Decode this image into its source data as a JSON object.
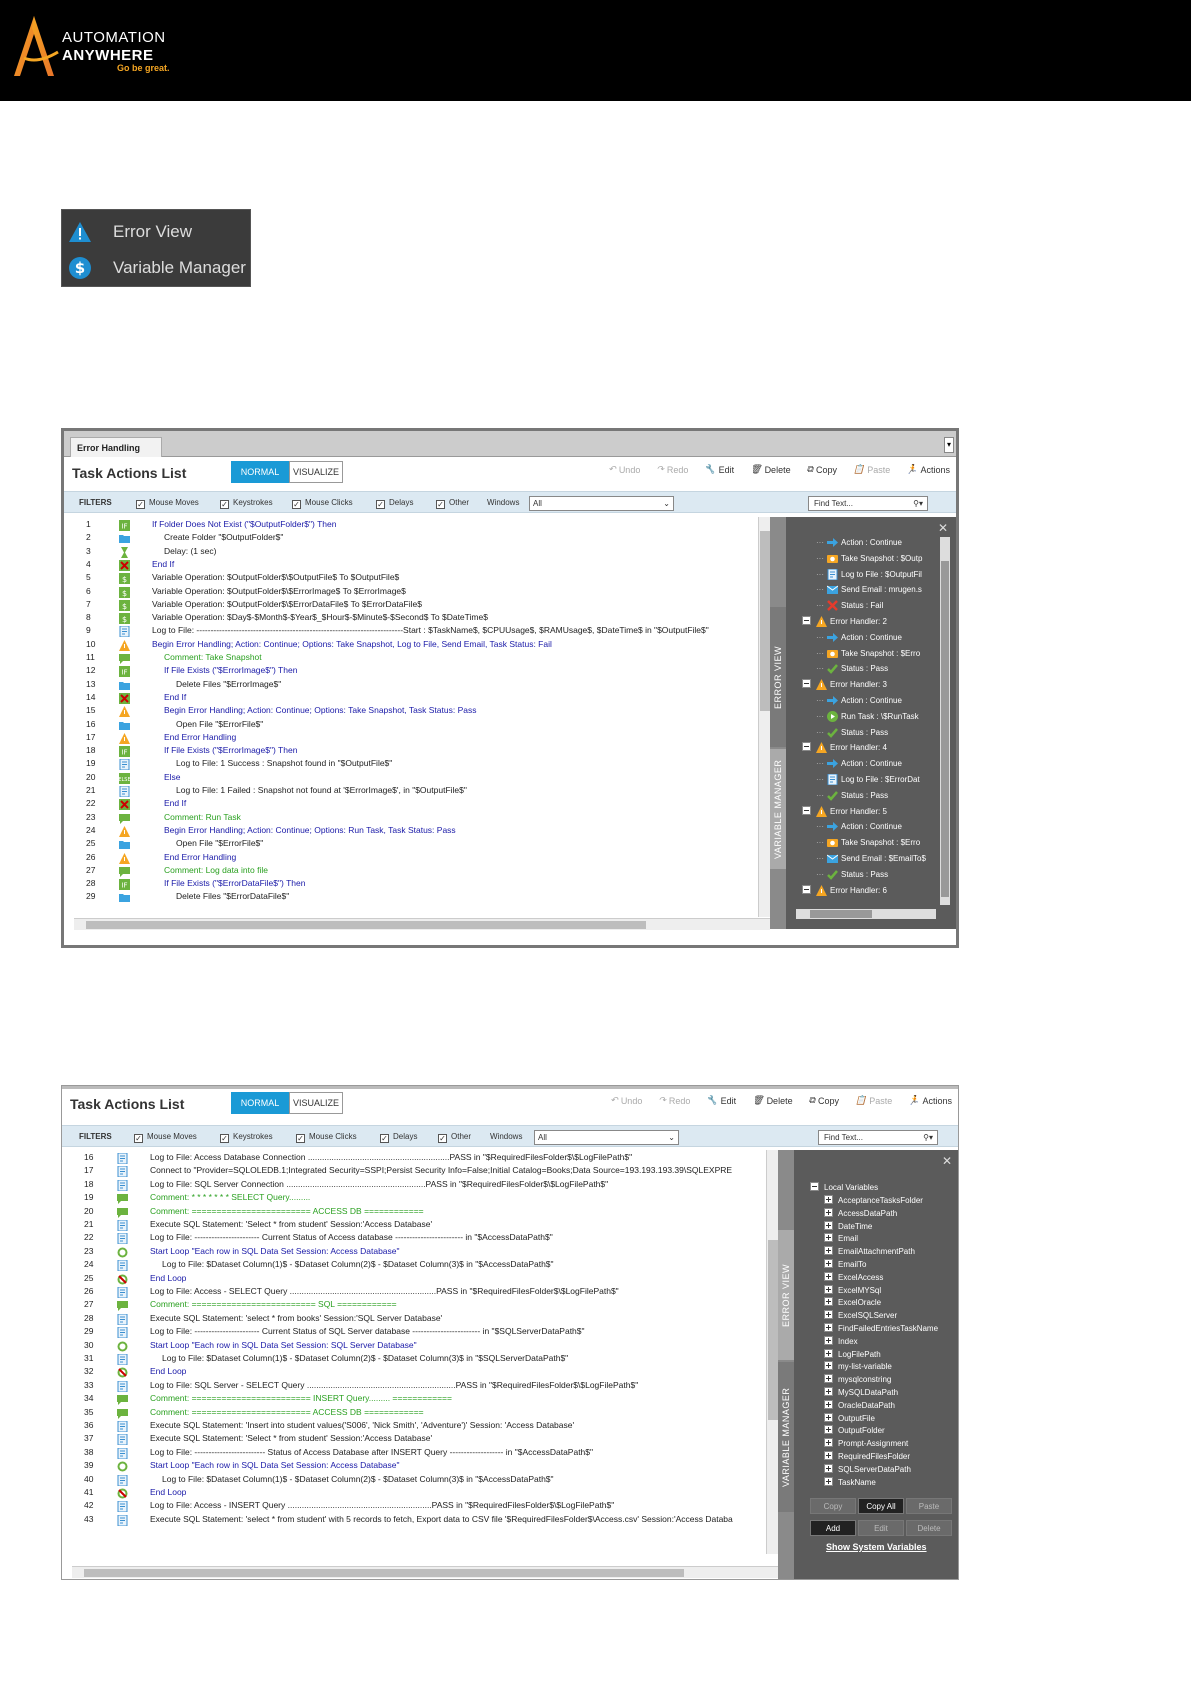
{
  "header": {
    "brand_line1": "AUTOMATION",
    "brand_line2": "ANYWHERE",
    "tagline": "Go be great."
  },
  "legend": {
    "items": [
      {
        "label": "Error View",
        "icon": "warning-icon"
      },
      {
        "label": "Variable Manager",
        "icon": "dollar-icon"
      }
    ]
  },
  "colors": {
    "accent": "#1a9ad6",
    "panel": "#5b5b5b",
    "warning": "#f5a623",
    "comment": "#2aa020",
    "keyword": "#1a1aa8"
  },
  "window1": {
    "tab_label": "Error Handling",
    "title": "Task Actions List",
    "modes": {
      "normal": "NORMAL",
      "visualize": "VISUALIZE"
    },
    "toolbar": {
      "undo": "Undo",
      "redo": "Redo",
      "edit": "Edit",
      "delete": "Delete",
      "copy": "Copy",
      "paste": "Paste",
      "actions": "Actions"
    },
    "filters": {
      "label": "FILTERS",
      "mouse_moves": "Mouse Moves",
      "keystrokes": "Keystrokes",
      "mouse_clicks": "Mouse Clicks",
      "delays": "Delays",
      "other": "Other",
      "windows_label": "Windows",
      "windows_value": "All",
      "find_placeholder": "Find Text..."
    },
    "lines": [
      {
        "n": "1",
        "ind": 0,
        "c": "blue",
        "i": "if",
        "t": "If Folder Does Not Exist (\"$OutputFolder$\") Then"
      },
      {
        "n": "2",
        "ind": 1,
        "c": "black",
        "i": "folder",
        "t": "Create Folder \"$OutputFolder$\""
      },
      {
        "n": "3",
        "ind": 1,
        "c": "black",
        "i": "delay",
        "t": "Delay: (1 sec)"
      },
      {
        "n": "4",
        "ind": 0,
        "c": "blue",
        "i": "endif",
        "t": "End If"
      },
      {
        "n": "5",
        "ind": 0,
        "c": "black",
        "i": "var",
        "t": "Variable Operation: $OutputFolder$\\$OutputFile$ To $OutputFile$"
      },
      {
        "n": "6",
        "ind": 0,
        "c": "black",
        "i": "var",
        "t": "Variable Operation: $OutputFolder$\\$ErrorImage$ To $ErrorImage$"
      },
      {
        "n": "7",
        "ind": 0,
        "c": "black",
        "i": "var",
        "t": "Variable Operation: $OutputFolder$\\$ErrorDataFile$ To $ErrorDataFile$"
      },
      {
        "n": "8",
        "ind": 0,
        "c": "black",
        "i": "var",
        "t": "Variable Operation: $Day$-$Month$-$Year$_$Hour$-$Minute$-$Second$ To $DateTime$"
      },
      {
        "n": "9",
        "ind": 0,
        "c": "black",
        "i": "log",
        "t": "Log to File: -------------------------------------------------------------------------Start : $TaskName$, $CPUUsage$, $RAMUsage$, $DateTime$ in \"$OutputFile$\""
      },
      {
        "n": "10",
        "ind": 0,
        "c": "blue",
        "i": "warn",
        "t": "Begin Error Handling; Action: Continue; Options: Take Snapshot, Log to File, Send Email,  Task Status: Fail"
      },
      {
        "n": "11",
        "ind": 1,
        "c": "green",
        "i": "comment",
        "t": "Comment: Take Snapshot"
      },
      {
        "n": "12",
        "ind": 1,
        "c": "blue",
        "i": "if",
        "t": "If File Exists (\"$ErrorImage$\") Then"
      },
      {
        "n": "13",
        "ind": 2,
        "c": "black",
        "i": "folder",
        "t": "Delete Files \"$ErrorImage$\""
      },
      {
        "n": "14",
        "ind": 1,
        "c": "blue",
        "i": "endif",
        "t": "End If"
      },
      {
        "n": "15",
        "ind": 1,
        "c": "blue",
        "i": "warn",
        "t": "Begin Error Handling; Action: Continue; Options: Take Snapshot,  Task Status: Pass"
      },
      {
        "n": "16",
        "ind": 2,
        "c": "black",
        "i": "folder",
        "t": "Open File \"$ErrorFile$\""
      },
      {
        "n": "17",
        "ind": 1,
        "c": "blue",
        "i": "warn",
        "t": "End Error Handling"
      },
      {
        "n": "18",
        "ind": 1,
        "c": "blue",
        "i": "if",
        "t": "If File Exists (\"$ErrorImage$\") Then"
      },
      {
        "n": "19",
        "ind": 2,
        "c": "black",
        "i": "log",
        "t": "Log to File: 1 Success : Snapshot found in \"$OutputFile$\""
      },
      {
        "n": "20",
        "ind": 1,
        "c": "blue",
        "i": "else",
        "t": "Else"
      },
      {
        "n": "21",
        "ind": 2,
        "c": "black",
        "i": "log",
        "t": "Log to File: 1 Failed : Snapshot not found at '$ErrorImage$', in \"$OutputFile$\""
      },
      {
        "n": "22",
        "ind": 1,
        "c": "blue",
        "i": "endif",
        "t": "End If"
      },
      {
        "n": "23",
        "ind": 1,
        "c": "green",
        "i": "comment",
        "t": "Comment: Run Task"
      },
      {
        "n": "24",
        "ind": 1,
        "c": "blue",
        "i": "warn",
        "t": "Begin Error Handling; Action: Continue; Options: Run Task,  Task Status: Pass"
      },
      {
        "n": "25",
        "ind": 2,
        "c": "black",
        "i": "folder",
        "t": "Open File \"$ErrorFile$\""
      },
      {
        "n": "26",
        "ind": 1,
        "c": "blue",
        "i": "warn",
        "t": "End Error Handling"
      },
      {
        "n": "27",
        "ind": 1,
        "c": "green",
        "i": "comment",
        "t": "Comment: Log data into file"
      },
      {
        "n": "28",
        "ind": 1,
        "c": "blue",
        "i": "if",
        "t": "If File Exists (\"$ErrorDataFile$\") Then"
      },
      {
        "n": "29",
        "ind": 2,
        "c": "black",
        "i": "folder",
        "t": "Delete Files \"$ErrorDataFile$\""
      }
    ],
    "side_tabs": {
      "error_view": "ERROR VIEW",
      "variable_manager": "VARIABLE MANAGER"
    },
    "error_tree": [
      {
        "lv": 1,
        "i": "arrow",
        "t": "Action : Continue"
      },
      {
        "lv": 1,
        "i": "camera",
        "t": "Take Snapshot : $Outp"
      },
      {
        "lv": 1,
        "i": "log",
        "t": "Log to File : $OutputFil"
      },
      {
        "lv": 1,
        "i": "mail",
        "t": "Send Email : mrugen.s"
      },
      {
        "lv": 1,
        "i": "x",
        "t": "Status : Fail"
      },
      {
        "lv": 0,
        "i": "warn",
        "t": "Error Handler: 2"
      },
      {
        "lv": 1,
        "i": "arrow",
        "t": "Action : Continue"
      },
      {
        "lv": 1,
        "i": "camera",
        "t": "Take Snapshot : $Erro"
      },
      {
        "lv": 1,
        "i": "check",
        "t": "Status : Pass"
      },
      {
        "lv": 0,
        "i": "warn",
        "t": "Error Handler: 3"
      },
      {
        "lv": 1,
        "i": "arrow",
        "t": "Action : Continue"
      },
      {
        "lv": 1,
        "i": "play",
        "t": "Run Task : \\$RunTask"
      },
      {
        "lv": 1,
        "i": "check",
        "t": "Status : Pass"
      },
      {
        "lv": 0,
        "i": "warn",
        "t": "Error Handler: 4"
      },
      {
        "lv": 1,
        "i": "arrow",
        "t": "Action : Continue"
      },
      {
        "lv": 1,
        "i": "log",
        "t": "Log to File : $ErrorDat"
      },
      {
        "lv": 1,
        "i": "check",
        "t": "Status : Pass"
      },
      {
        "lv": 0,
        "i": "warn",
        "t": "Error Handler: 5"
      },
      {
        "lv": 1,
        "i": "arrow",
        "t": "Action : Continue"
      },
      {
        "lv": 1,
        "i": "camera",
        "t": "Take Snapshot : $Erro"
      },
      {
        "lv": 1,
        "i": "mail",
        "t": "Send Email : $EmailTo$"
      },
      {
        "lv": 1,
        "i": "check",
        "t": "Status : Pass"
      },
      {
        "lv": 0,
        "i": "warn",
        "t": "Error Handler: 6"
      }
    ]
  },
  "window2": {
    "title": "Task Actions List",
    "modes": {
      "normal": "NORMAL",
      "visualize": "VISUALIZE"
    },
    "toolbar": {
      "undo": "Undo",
      "redo": "Redo",
      "edit": "Edit",
      "delete": "Delete",
      "copy": "Copy",
      "paste": "Paste",
      "actions": "Actions"
    },
    "filters": {
      "label": "FILTERS",
      "mouse_moves": "Mouse Moves",
      "keystrokes": "Keystrokes",
      "mouse_clicks": "Mouse Clicks",
      "delays": "Delays",
      "other": "Other",
      "windows_label": "Windows",
      "windows_value": "All",
      "find_placeholder": "Find Text..."
    },
    "lines": [
      {
        "n": "16",
        "ind": 0,
        "c": "black",
        "i": "log",
        "t": "Log to File: Access Database Connection ............................................................PASS in \"$RequiredFilesFolder$\\$LogFilePath$\""
      },
      {
        "n": "17",
        "ind": 0,
        "c": "black",
        "i": "log",
        "t": "Connect to \"Provider=SQLOLEDB.1;Integrated Security=SSPI;Persist Security Info=False;Initial Catalog=Books;Data Source=193.193.193.39\\SQLEXPRE"
      },
      {
        "n": "18",
        "ind": 0,
        "c": "black",
        "i": "log",
        "t": "Log to File: SQL Server Connection ...........................................................PASS in \"$RequiredFilesFolder$\\$LogFilePath$\""
      },
      {
        "n": "19",
        "ind": 0,
        "c": "green",
        "i": "comment",
        "t": "Comment: * * * * * * *                   SELECT Query........."
      },
      {
        "n": "20",
        "ind": 0,
        "c": "green",
        "i": "comment",
        "t": "Comment: ========================     ACCESS DB ============"
      },
      {
        "n": "21",
        "ind": 0,
        "c": "black",
        "i": "log",
        "t": "Execute SQL Statement: 'Select * from student' Session:'Access Database'"
      },
      {
        "n": "22",
        "ind": 0,
        "c": "black",
        "i": "log",
        "t": "Log to File: ----------------------- Current Status of Access database ------------------------ in \"$AccessDataPath$\""
      },
      {
        "n": "23",
        "ind": 0,
        "c": "blue",
        "i": "loop",
        "t": "Start Loop \"Each row in SQL Data Set Session: Access Database\""
      },
      {
        "n": "24",
        "ind": 1,
        "c": "black",
        "i": "log",
        "t": "Log to File: $Dataset Column(1)$ - $Dataset Column(2)$ - $Dataset Column(3)$ in \"$AccessDataPath$\""
      },
      {
        "n": "25",
        "ind": 0,
        "c": "blue",
        "i": "endloop",
        "t": "End Loop"
      },
      {
        "n": "26",
        "ind": 0,
        "c": "black",
        "i": "log",
        "t": "Log to File: Access - SELECT Query ..............................................................PASS in \"$RequiredFilesFolder$\\$LogFilePath$\""
      },
      {
        "n": "27",
        "ind": 0,
        "c": "green",
        "i": "comment",
        "t": "Comment: ========================= SQL   ============"
      },
      {
        "n": "28",
        "ind": 0,
        "c": "black",
        "i": "log",
        "t": "Execute SQL Statement: 'select * from books' Session:'SQL Server Database'"
      },
      {
        "n": "29",
        "ind": 0,
        "c": "black",
        "i": "log",
        "t": "Log to File: ----------------------- Current Status of SQL Server database ------------------------ in \"$SQLServerDataPath$\""
      },
      {
        "n": "30",
        "ind": 0,
        "c": "blue",
        "i": "loop",
        "t": "Start Loop \"Each row in SQL Data Set Session: SQL Server Database\""
      },
      {
        "n": "31",
        "ind": 1,
        "c": "black",
        "i": "log",
        "t": "Log to File: $Dataset Column(1)$ - $Dataset Column(2)$ - $Dataset Column(3)$ in \"$SQLServerDataPath$\""
      },
      {
        "n": "32",
        "ind": 0,
        "c": "blue",
        "i": "endloop",
        "t": "End Loop"
      },
      {
        "n": "33",
        "ind": 0,
        "c": "black",
        "i": "log",
        "t": "Log to File: SQL Server - SELECT Query ...............................................................PASS in \"$RequiredFilesFolder$\\$LogFilePath$\""
      },
      {
        "n": "34",
        "ind": 0,
        "c": "green",
        "i": "comment",
        "t": "Comment: ========================               INSERT Query.........    ============"
      },
      {
        "n": "35",
        "ind": 0,
        "c": "green",
        "i": "comment",
        "t": "Comment: ========================     ACCESS DB ============"
      },
      {
        "n": "36",
        "ind": 0,
        "c": "black",
        "i": "log",
        "t": "Execute SQL Statement: 'Insert into student values('S006', 'Nick Smith', 'Adventure')' Session: 'Access Database'"
      },
      {
        "n": "37",
        "ind": 0,
        "c": "black",
        "i": "log",
        "t": "Execute SQL Statement: 'Select * from student' Session:'Access Database'"
      },
      {
        "n": "38",
        "ind": 0,
        "c": "black",
        "i": "log",
        "t": "Log to File: ------------------------- Status of Access Database after INSERT Query ------------------- in \"$AccessDataPath$\""
      },
      {
        "n": "39",
        "ind": 0,
        "c": "blue",
        "i": "loop",
        "t": "Start Loop \"Each row in SQL Data Set Session: Access Database\""
      },
      {
        "n": "40",
        "ind": 1,
        "c": "black",
        "i": "log",
        "t": "Log to File: $Dataset Column(1)$ - $Dataset Column(2)$ - $Dataset Column(3)$ in \"$AccessDataPath$\""
      },
      {
        "n": "41",
        "ind": 0,
        "c": "blue",
        "i": "endloop",
        "t": "End Loop"
      },
      {
        "n": "42",
        "ind": 0,
        "c": "black",
        "i": "log",
        "t": "Log to File: Access - INSERT Query .............................................................PASS in \"$RequiredFilesFolder$\\$LogFilePath$\""
      },
      {
        "n": "43",
        "ind": 0,
        "c": "black",
        "i": "log",
        "t": "Execute SQL Statement: 'select * from student' with 5 records to fetch, Export data to CSV file '$RequiredFilesFolder$\\Access.csv' Session:'Access Databa"
      }
    ],
    "side_tabs": {
      "error_view": "ERROR VIEW",
      "variable_manager": "VARIABLE MANAGER"
    },
    "variables_root": "Local Variables",
    "variables": [
      "AcceptanceTasksFolder",
      "AccessDataPath",
      "DateTime",
      "Email",
      "EmailAttachmentPath",
      "EmailTo",
      "ExcelAccess",
      "ExcelMYSql",
      "ExcelOracle",
      "ExcelSQLServer",
      "FindFailedEntriesTaskName",
      "Index",
      "LogFilePath",
      "my-list-variable",
      "mysqlconstring",
      "MySQLDataPath",
      "OracleDataPath",
      "OutputFile",
      "OutputFolder",
      "Prompt-Assignment",
      "RequiredFilesFolder",
      "SQLServerDataPath",
      "TaskName"
    ],
    "buttons": {
      "copy": "Copy",
      "copy_all": "Copy All",
      "paste": "Paste",
      "add": "Add",
      "edit": "Edit",
      "delete": "Delete",
      "show_system": "Show System Variables"
    }
  }
}
